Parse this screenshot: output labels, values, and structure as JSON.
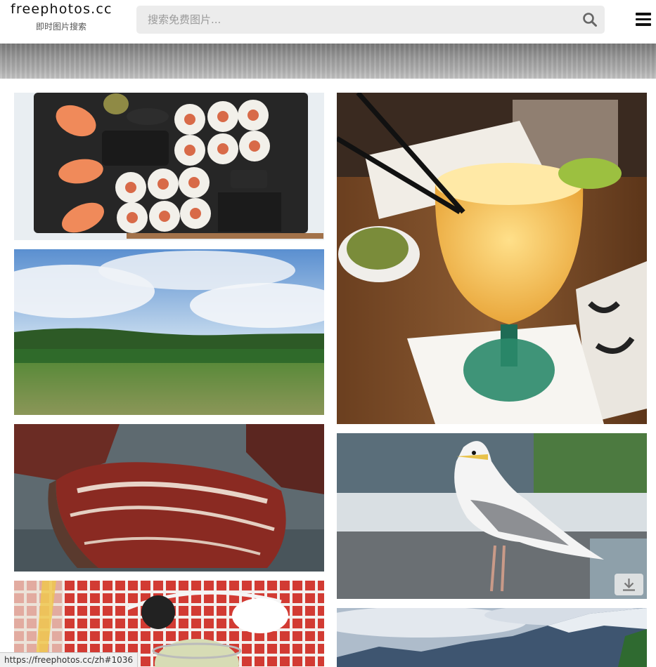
{
  "header": {
    "logo_text": "freephotos.cc",
    "logo_subtitle": "即时图片搜索",
    "search_placeholder": "搜索免费图片...",
    "search_icon": "magnifier-icon",
    "menu_icon": "hamburger-menu-icon"
  },
  "photos": [
    {
      "name": "photo-sushi",
      "subject": "sushi"
    },
    {
      "name": "photo-green-field",
      "subject": "field"
    },
    {
      "name": "photo-raw-steak",
      "subject": "steak"
    },
    {
      "name": "photo-drink-table",
      "subject": "drink"
    },
    {
      "name": "photo-frozen-cocktail",
      "subject": "cocktail"
    },
    {
      "name": "photo-seagull",
      "subject": "seagull"
    },
    {
      "name": "photo-mountains",
      "subject": "mountains"
    }
  ],
  "download_icon": "download-arrow-icon",
  "status_bar": {
    "url": "https://freephotos.cc/zh#1036"
  },
  "colors": {
    "header_bg": "#ffffff",
    "search_bg": "#ececec",
    "text_dark": "#111111"
  }
}
